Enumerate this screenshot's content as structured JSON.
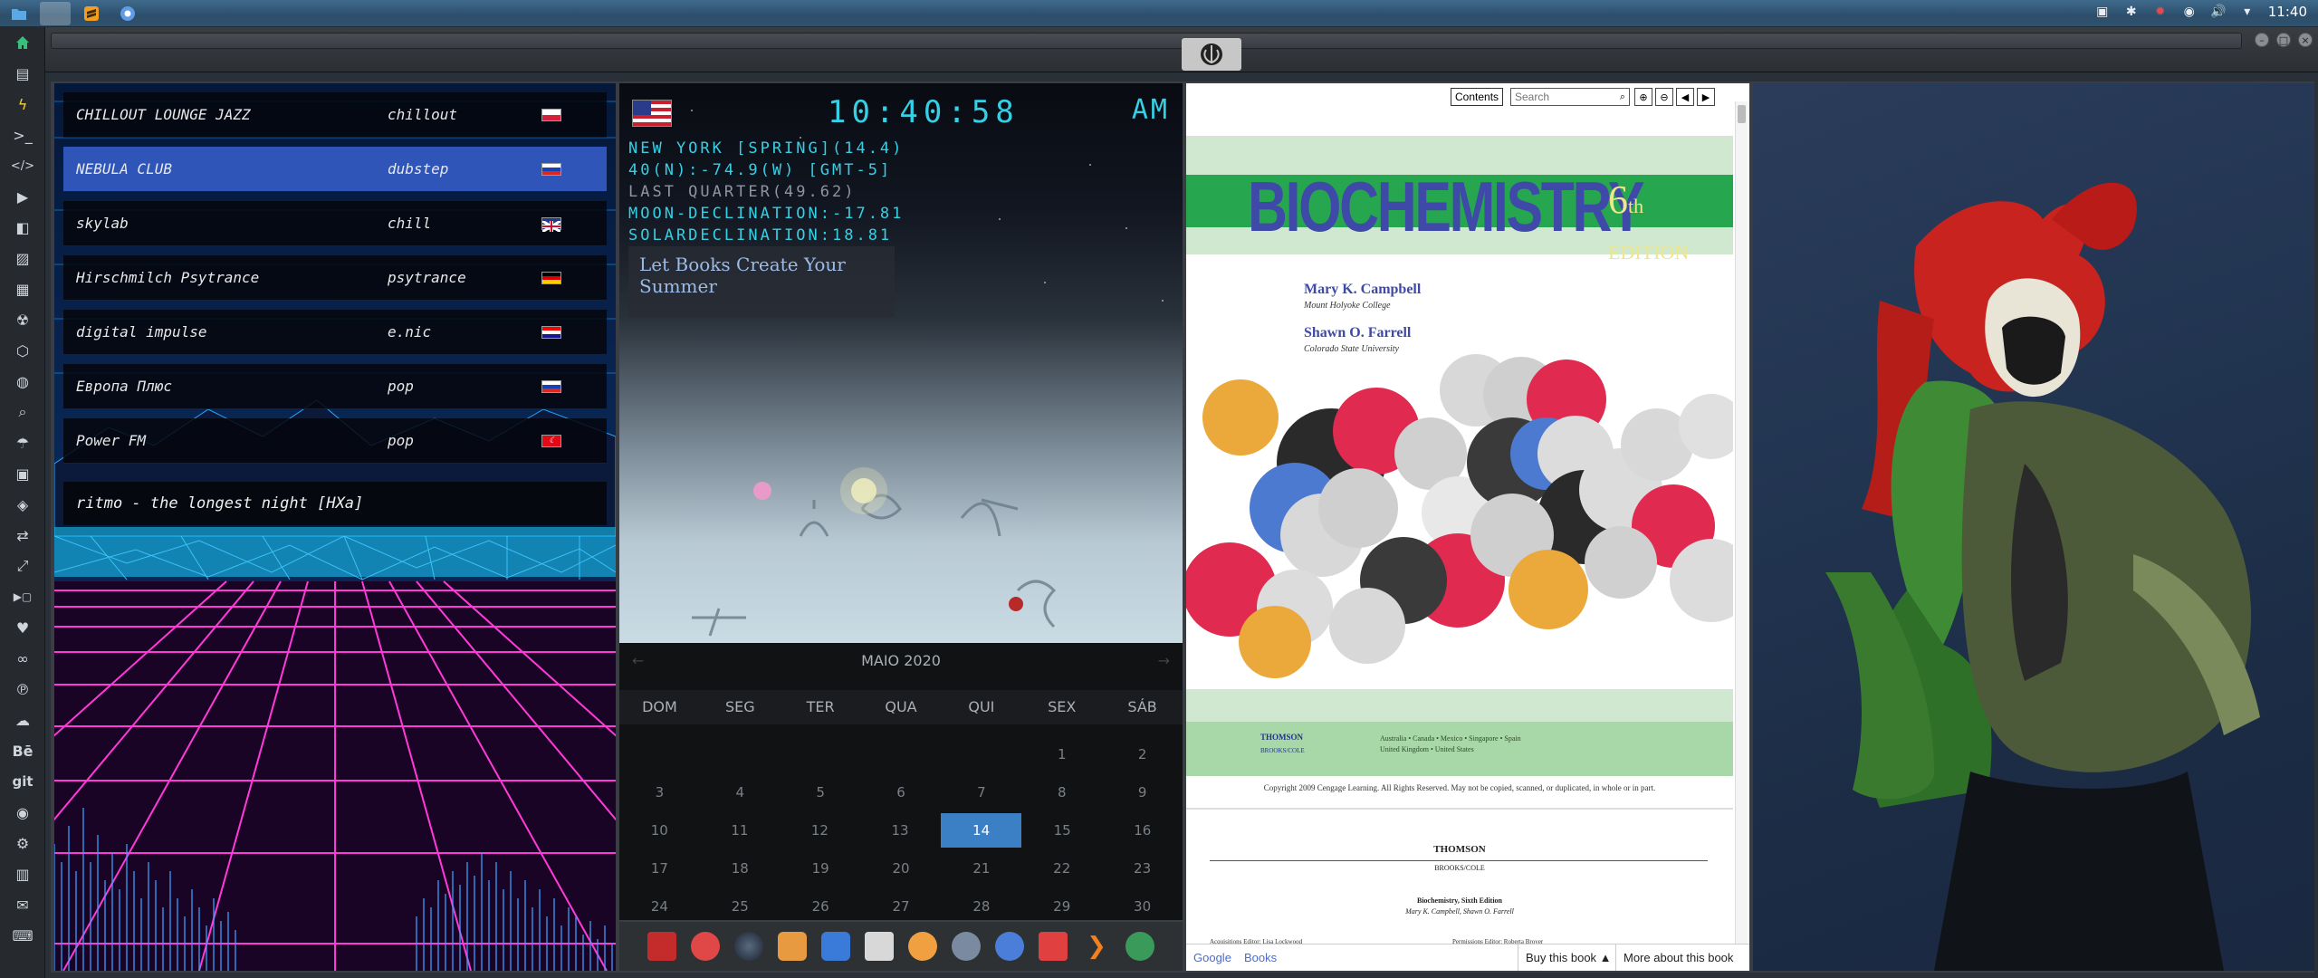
{
  "taskbar": {
    "apps": [
      "files-icon",
      "blank-window",
      "sublime-icon",
      "chrome-icon"
    ],
    "clock": "11:40"
  },
  "sidebar": {
    "icons": [
      "home-icon",
      "document-icon",
      "bolt-icon",
      "terminal-icon",
      "code-icon",
      "play-icon",
      "video-icon",
      "image-icon",
      "news-icon",
      "radiation-icon",
      "box-icon",
      "globe-icon",
      "search-icon",
      "umbrella-icon",
      "contact-icon",
      "ticket-icon",
      "exchange-icon",
      "expand-icon",
      "youtube-icon",
      "heart-icon",
      "infinity-icon",
      "pinterest-icon",
      "cloud-icon",
      "behance-icon",
      "git-icon",
      "github-icon",
      "gears-icon",
      "map-icon",
      "mail-icon",
      "keyboard-icon"
    ],
    "text_icons": {
      "behance": "Bē",
      "git": "git"
    }
  },
  "radio": {
    "stations": [
      {
        "name": "CHILLOUT LOUNGE JAZZ",
        "genre": "chillout",
        "flag": "pl"
      },
      {
        "name": "NEBULA CLUB",
        "genre": "dubstep",
        "flag": "ru"
      },
      {
        "name": "skylab",
        "genre": "chill",
        "flag": "gb"
      },
      {
        "name": "Hirschmilch Psytrance",
        "genre": "psytrance",
        "flag": "de"
      },
      {
        "name": "digital impulse",
        "genre": "e.nic",
        "flag": "hr"
      },
      {
        "name": "Европа Плюс",
        "genre": "pop",
        "flag": "ru"
      },
      {
        "name": "Power FM",
        "genre": "pop",
        "flag": "tr"
      }
    ],
    "now_playing": "ritmo - the longest night [HXa]"
  },
  "clock": {
    "time": "10:40:58",
    "ampm": "AM",
    "lines": [
      "NEW YORK [SPRING](14.4)",
      "40(N):-74.9(W) [GMT-5]",
      "LAST QUARTER(49.62)",
      "MOON-DECLINATION:-17.81",
      "SOLARDECLINATION:18.81"
    ],
    "ad_text": "Let Books Create Your Summer"
  },
  "calendar": {
    "title": "MAIO 2020",
    "weekdays": [
      "DOM",
      "SEG",
      "TER",
      "QUA",
      "QUI",
      "SEX",
      "SÁB"
    ],
    "weeks": [
      [
        "",
        "",
        "",
        "",
        "",
        "1",
        "2"
      ],
      [
        "3",
        "4",
        "5",
        "6",
        "7",
        "8",
        "9"
      ],
      [
        "10",
        "11",
        "12",
        "13",
        "14",
        "15",
        "16"
      ],
      [
        "17",
        "18",
        "19",
        "20",
        "21",
        "22",
        "23"
      ],
      [
        "24",
        "25",
        "26",
        "27",
        "28",
        "29",
        "30"
      ]
    ],
    "today": "14"
  },
  "book": {
    "contents_label": "Contents",
    "search_placeholder": "Search",
    "title": "BIOCHEMISTRY",
    "edition_num": "6",
    "edition_suffix": "th",
    "edition_word": "EDITION",
    "authors": [
      {
        "name": "Mary K. Campbell",
        "affil": "Mount Holyoke College"
      },
      {
        "name": "Shawn O. Farrell",
        "affil": "Colorado State University"
      }
    ],
    "publisher": "THOMSON",
    "publisher_sub": "BROOKS/COLE",
    "locations": "Australia • Canada • Mexico • Singapore • Spain",
    "locations2": "United Kingdom • United States",
    "copyright": "Copyright 2009 Cengage Learning. All Rights Reserved. May not be copied, scanned, or duplicated, in whole or in part.",
    "page2_title": "Biochemistry, Sixth Edition",
    "page2_authors": "Mary K. Campbell, Shawn O. Farrell",
    "page2_left": "Acquisitions Editor: Lisa Lockwood",
    "page2_right": "Permissions Editor: Roberta Broyer",
    "google": "Google",
    "books": "Books",
    "buy_label": "Buy this book ▲",
    "more_label": "More about this book"
  },
  "colors": {
    "accent": "#2e55b7",
    "clock_cyan": "#35d0e6",
    "today": "#3b7fc4",
    "title_blue": "#3f4aa8",
    "green_strip": "#27a650"
  }
}
